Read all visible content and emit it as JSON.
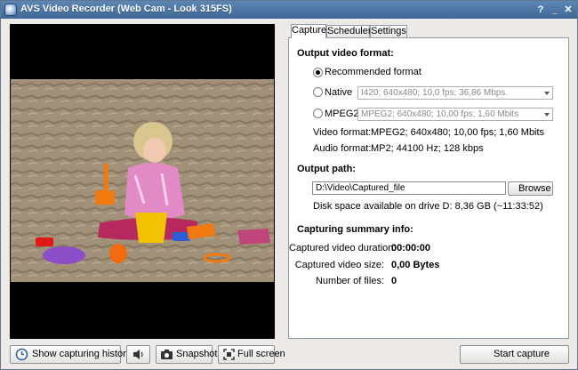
{
  "window": {
    "title": "AVS Video Recorder (Web Cam - Look 315FS)",
    "help_glyph": "?",
    "minimize_glyph": "_",
    "close_glyph": "✕"
  },
  "tabs": [
    {
      "label": "Capture",
      "active": true
    },
    {
      "label": "Scheduler",
      "active": false
    },
    {
      "label": "Settings",
      "active": false
    }
  ],
  "output_format": {
    "section_title": "Output video format:",
    "recommended_label": "Recommended format",
    "native_label": "Native",
    "native_value": "I420; 640x480; 10,0 fps; 36,86 Mbps.",
    "mpeg2_label": "MPEG2",
    "mpeg2_value": "MPEG2; 640x480; 10,00 fps; 1,60 Mbits",
    "selected": "Recommended format",
    "video_format_label": "Video format:",
    "video_format_value": "MPEG2; 640x480; 10,00 fps; 1,60 Mbits",
    "audio_format_label": "Audio format:",
    "audio_format_value": "MP2; 44100 Hz; 128 kbps"
  },
  "output_path": {
    "section_title": "Output path:",
    "path_value": "D:\\Video\\Captured_file",
    "browse_label": "Browse",
    "disk_space": "Disk space available on drive D: 8,36 GB (~11:33:52)"
  },
  "summary": {
    "section_title": "Capturing summary info:",
    "duration_label": "Captured video duration:",
    "duration_value": "00:00:00",
    "size_label": "Captured video size:",
    "size_value": "0,00 Bytes",
    "files_label": "Number of files:",
    "files_value": "0"
  },
  "bottom": {
    "history_label": "Show capturing history",
    "snapshot_label": "Snapshot",
    "fullscreen_label": "Full screen",
    "start_label": "Start capture"
  },
  "colors": {
    "titlebar": "#4a74a3",
    "window_bg": "#ece9e6",
    "preview_bg": "#000000"
  }
}
